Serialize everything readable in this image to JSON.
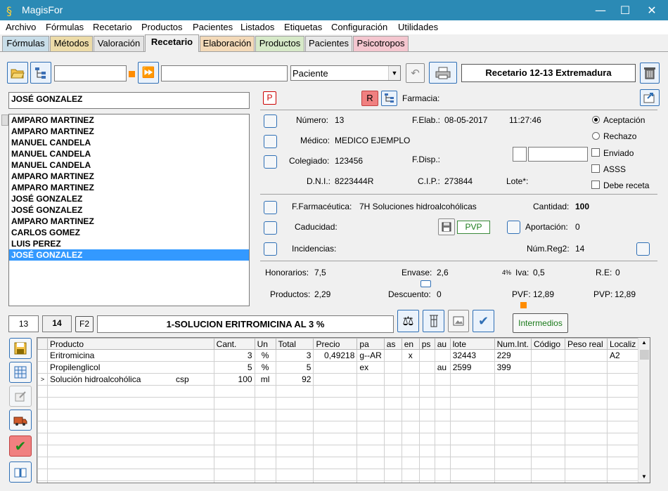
{
  "window": {
    "title": "MagisFor"
  },
  "menu": [
    "Archivo",
    "Fórmulas",
    "Recetario",
    "Productos",
    "Pacientes",
    "Listados",
    "Etiquetas",
    "Configuración",
    "Utilidades"
  ],
  "tabs": [
    {
      "label": "Fórmulas",
      "color": "#c8dde8"
    },
    {
      "label": "Métodos",
      "color": "#ecdba8"
    },
    {
      "label": "Valoración",
      "color": "#e4e4e4"
    },
    {
      "label": "Recetario",
      "color": "#f0f0f0"
    },
    {
      "label": "Elaboración",
      "color": "#f3d9b8"
    },
    {
      "label": "Productos",
      "color": "#d6e9c8"
    },
    {
      "label": "Pacientes",
      "color": "#e8e8e8"
    },
    {
      "label": "Psicotropos",
      "color": "#f4c6cf"
    }
  ],
  "toolbar": {
    "search1": "",
    "search2": "",
    "paciente_select": "Paciente",
    "recetario_title": "Recetario 12-13 Extremadura"
  },
  "patient": {
    "name": "JOSÉ GONZALEZ"
  },
  "patient_list": [
    "AMPARO MARTINEZ",
    "AMPARO MARTINEZ",
    "MANUEL CANDELA",
    "MANUEL CANDELA",
    "MANUEL CANDELA",
    "AMPARO MARTINEZ",
    "AMPARO MARTINEZ",
    "JOSÉ GONZALEZ",
    "JOSÉ GONZALEZ",
    "AMPARO MARTINEZ",
    "CARLOS GOMEZ",
    "LUIS PEREZ",
    "JOSÉ GONZALEZ"
  ],
  "header_row": {
    "p_label": "P",
    "r_label": "R",
    "farmacia_label": "Farmacia:"
  },
  "details": {
    "numero_label": "Número:",
    "numero": "13",
    "felab_label": "F.Elab.:",
    "felab": "08-05-2017",
    "time": "11:27:46",
    "medico_label": "Médico:",
    "medico": "MEDICO EJEMPLO",
    "colegiado_label": "Colegiado:",
    "colegiado": "123456",
    "fdisp_label": "F.Disp.:",
    "dni_label": "D.N.I.:",
    "dni": "8223444R",
    "cip_label": "C.I.P.:",
    "cip": "273844",
    "lote_label": "Lote*:"
  },
  "options": {
    "aceptacion": "Aceptación",
    "rechazo": "Rechazo",
    "enviado": "Enviado",
    "asss": "ASSS",
    "debe_receta": "Debe receta"
  },
  "ff": {
    "label": "F.Farmacéutica:",
    "value": "7H Soluciones hidroalcohólicas",
    "cantidad_label": "Cantidad:",
    "cantidad": "100",
    "caducidad_label": "Caducidad:",
    "pvp_btn": "PVP",
    "aportacion_label": "Aportación:",
    "aportacion": "0",
    "incidencias_label": "Incidencias:",
    "numreg2_label": "Núm.Reg2:",
    "numreg2": "14"
  },
  "totals": {
    "honorarios_label": "Honorarios:",
    "honorarios": "7,5",
    "envase_label": "Envase:",
    "envase": "2,6",
    "iva_pct": "4%",
    "iva_label": "Iva:",
    "iva": "0,5",
    "re_label": "R.E:",
    "re": "0",
    "productos_label": "Productos:",
    "productos": "2,29",
    "descuento_label": "Descuento:",
    "descuento": "0",
    "pvf_label": "PVF:",
    "pvf": "12,89",
    "pvp_label": "PVP:",
    "pvp": "12,89"
  },
  "formula_bar": {
    "num1": "13",
    "num2": "14",
    "f2": "F2",
    "name": "1-SOLUCION ERITROMICINA AL 3 %",
    "intermedios": "Intermedios"
  },
  "grid": {
    "columns": [
      "Producto",
      "Cant.",
      "Un",
      "Total",
      "Precio",
      "pa",
      "as",
      "en",
      "ps",
      "au",
      "lote",
      "Num.Int.",
      "Código",
      "Peso real",
      "Localiz"
    ],
    "rows": [
      {
        "marker": "",
        "producto": "Eritromicina",
        "extra": "",
        "cant": "3",
        "un": "%",
        "total": "3",
        "precio": "0,49218",
        "pa": "g--AR",
        "as": "",
        "en": "x",
        "ps": "",
        "au": "",
        "lote": "32443",
        "numint": "229",
        "codigo": "",
        "peso": "",
        "localiz": "A2"
      },
      {
        "marker": "",
        "producto": "Propilenglicol",
        "extra": "",
        "cant": "5",
        "un": "%",
        "total": "5",
        "precio": "",
        "pa": "ex",
        "as": "",
        "en": "",
        "ps": "",
        "au": "au",
        "lote": "2599",
        "numint": "399",
        "codigo": "",
        "peso": "",
        "localiz": ""
      },
      {
        "marker": ">",
        "producto": "Solución hidroalcohólica",
        "extra": "csp",
        "cant": "100",
        "un": "ml",
        "total": "92",
        "precio": "",
        "pa": "",
        "as": "",
        "en": "",
        "ps": "",
        "au": "",
        "lote": "",
        "numint": "",
        "codigo": "",
        "peso": "",
        "localiz": ""
      }
    ]
  }
}
